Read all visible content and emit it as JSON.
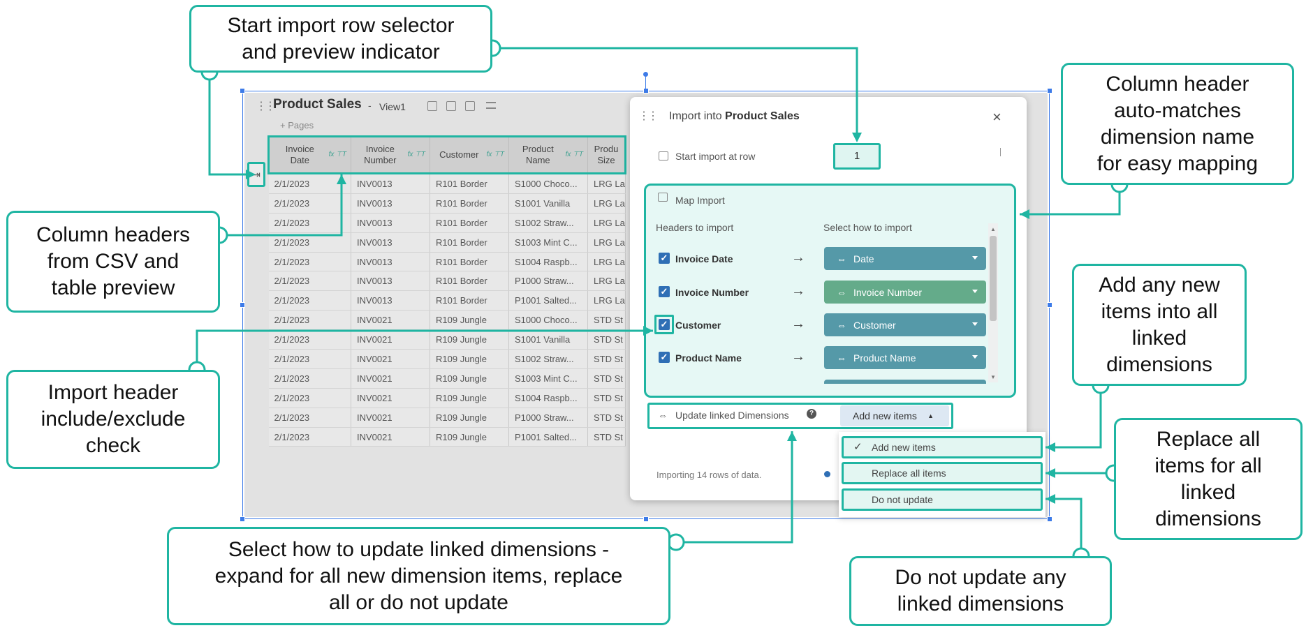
{
  "grid": {
    "title": "Product Sales",
    "separator": "-",
    "view_name": "View1",
    "pages_link": "+ Pages",
    "columns": [
      {
        "line1": "Invoice",
        "line2": "Date",
        "icons": "fx ⊤T"
      },
      {
        "line1": "Invoice",
        "line2": "Number",
        "icons": "fx ⊤T"
      },
      {
        "line1": "Customer",
        "line2": "",
        "icons": "fx ⊤T"
      },
      {
        "line1": "Product",
        "line2": "Name",
        "icons": "fx ⊤T"
      },
      {
        "line1": "Produ",
        "line2": "Size",
        "icons": ""
      }
    ],
    "rows": [
      [
        "2/1/2023",
        "INV0013",
        "R101 Border",
        "S1000 Choco...",
        "LRG La"
      ],
      [
        "2/1/2023",
        "INV0013",
        "R101 Border",
        "S1001 Vanilla",
        "LRG La"
      ],
      [
        "2/1/2023",
        "INV0013",
        "R101 Border",
        "S1002 Straw...",
        "LRG La"
      ],
      [
        "2/1/2023",
        "INV0013",
        "R101 Border",
        "S1003 Mint C...",
        "LRG La"
      ],
      [
        "2/1/2023",
        "INV0013",
        "R101 Border",
        "S1004 Raspb...",
        "LRG La"
      ],
      [
        "2/1/2023",
        "INV0013",
        "R101 Border",
        "P1000 Straw...",
        "LRG La"
      ],
      [
        "2/1/2023",
        "INV0013",
        "R101 Border",
        "P1001 Salted...",
        "LRG La"
      ],
      [
        "2/1/2023",
        "INV0021",
        "R109 Jungle",
        "S1000 Choco...",
        "STD St"
      ],
      [
        "2/1/2023",
        "INV0021",
        "R109 Jungle",
        "S1001 Vanilla",
        "STD St"
      ],
      [
        "2/1/2023",
        "INV0021",
        "R109 Jungle",
        "S1002 Straw...",
        "STD St"
      ],
      [
        "2/1/2023",
        "INV0021",
        "R109 Jungle",
        "S1003 Mint C...",
        "STD St"
      ],
      [
        "2/1/2023",
        "INV0021",
        "R109 Jungle",
        "S1004 Raspb...",
        "STD St"
      ],
      [
        "2/1/2023",
        "INV0021",
        "R109 Jungle",
        "P1000 Straw...",
        "STD St"
      ],
      [
        "2/1/2023",
        "INV0021",
        "R109 Jungle",
        "P1001 Salted...",
        "STD St"
      ]
    ]
  },
  "modal": {
    "title_prefix": "Import into ",
    "title_target": "Product Sales",
    "close": "×",
    "start_row_label": "Start import at row",
    "start_row_value": "1",
    "map_title": "Map Import",
    "headers_col": "Headers to import",
    "select_col": "Select how to import",
    "mappings": [
      {
        "header": "Invoice Date",
        "target": "Date",
        "checked": true
      },
      {
        "header": "Invoice Number",
        "target": "Invoice Number",
        "checked": true
      },
      {
        "header": "Customer",
        "target": "Customer",
        "checked": true
      },
      {
        "header": "Product Name",
        "target": "Product Name",
        "checked": true
      }
    ],
    "update_label": "Update linked Dimensions",
    "update_value": "Add new items",
    "update_options": [
      "Add new items",
      "Replace all items",
      "Do not update"
    ],
    "footer": "Importing 14 rows of data."
  },
  "callouts": {
    "start_row": [
      "Start import row selector",
      "and preview indicator"
    ],
    "auto_match": [
      "Column header",
      "auto-matches",
      "dimension name",
      "for easy mapping"
    ],
    "headers_csv": [
      "Column headers",
      "from CSV and",
      "table preview"
    ],
    "add_new": [
      "Add any new",
      "items into all",
      "linked",
      "dimensions"
    ],
    "include_exclude": [
      "Import header",
      "include/exclude",
      "check"
    ],
    "replace_all": [
      "Replace all",
      "items for all",
      "linked",
      "dimensions"
    ],
    "select_how": [
      "Select how to update linked dimensions -",
      "expand for all new dimension items, replace",
      "all or do not update"
    ],
    "do_not_update": [
      "Do not update any",
      "linked dimensions"
    ]
  },
  "colors": {
    "accent": "#1fb5a2",
    "pill_blue": "#5599a8",
    "pill_green": "#64ab8a",
    "check_blue": "#2f6fb5"
  }
}
